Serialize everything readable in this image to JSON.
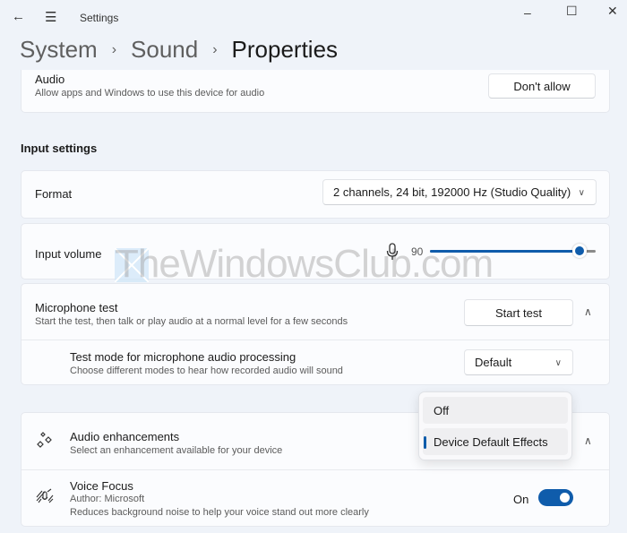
{
  "window": {
    "title": "Settings",
    "controls": {
      "minimize": "–",
      "maximize": "☐",
      "close": "✕"
    }
  },
  "breadcrumb": {
    "items": [
      "System",
      "Sound"
    ],
    "current": "Properties",
    "separator": "›"
  },
  "audio_card": {
    "title": "Audio",
    "subtitle": "Allow apps and Windows to use this device for audio",
    "button": "Don't allow"
  },
  "input_settings": {
    "heading": "Input settings",
    "format": {
      "label": "Format",
      "value": "2 channels, 24 bit, 192000 Hz (Studio Quality)"
    },
    "input_volume": {
      "label": "Input volume",
      "value": "90",
      "level_percent": 90
    },
    "mic_test": {
      "title": "Microphone test",
      "subtitle": "Start the test, then talk or play audio at a normal level for a few seconds",
      "button": "Start test"
    },
    "test_mode": {
      "title": "Test mode for microphone audio processing",
      "subtitle": "Choose different modes to hear how recorded audio will sound",
      "value": "Default"
    },
    "enhancements": {
      "title": "Audio enhancements",
      "subtitle": "Select an enhancement available for your device",
      "options": [
        "Off",
        "Device Default Effects"
      ],
      "selected": "Device Default Effects"
    },
    "voice_focus": {
      "title": "Voice Focus",
      "author": "Author: Microsoft",
      "description": "Reduces background noise to help your voice stand out more clearly",
      "state_label": "On",
      "enabled": true
    }
  },
  "watermark": {
    "text": "TheWindowsClub.com"
  },
  "colors": {
    "accent": "#0f5cab",
    "background": "#eff3f9",
    "card": "#fbfcfe"
  }
}
